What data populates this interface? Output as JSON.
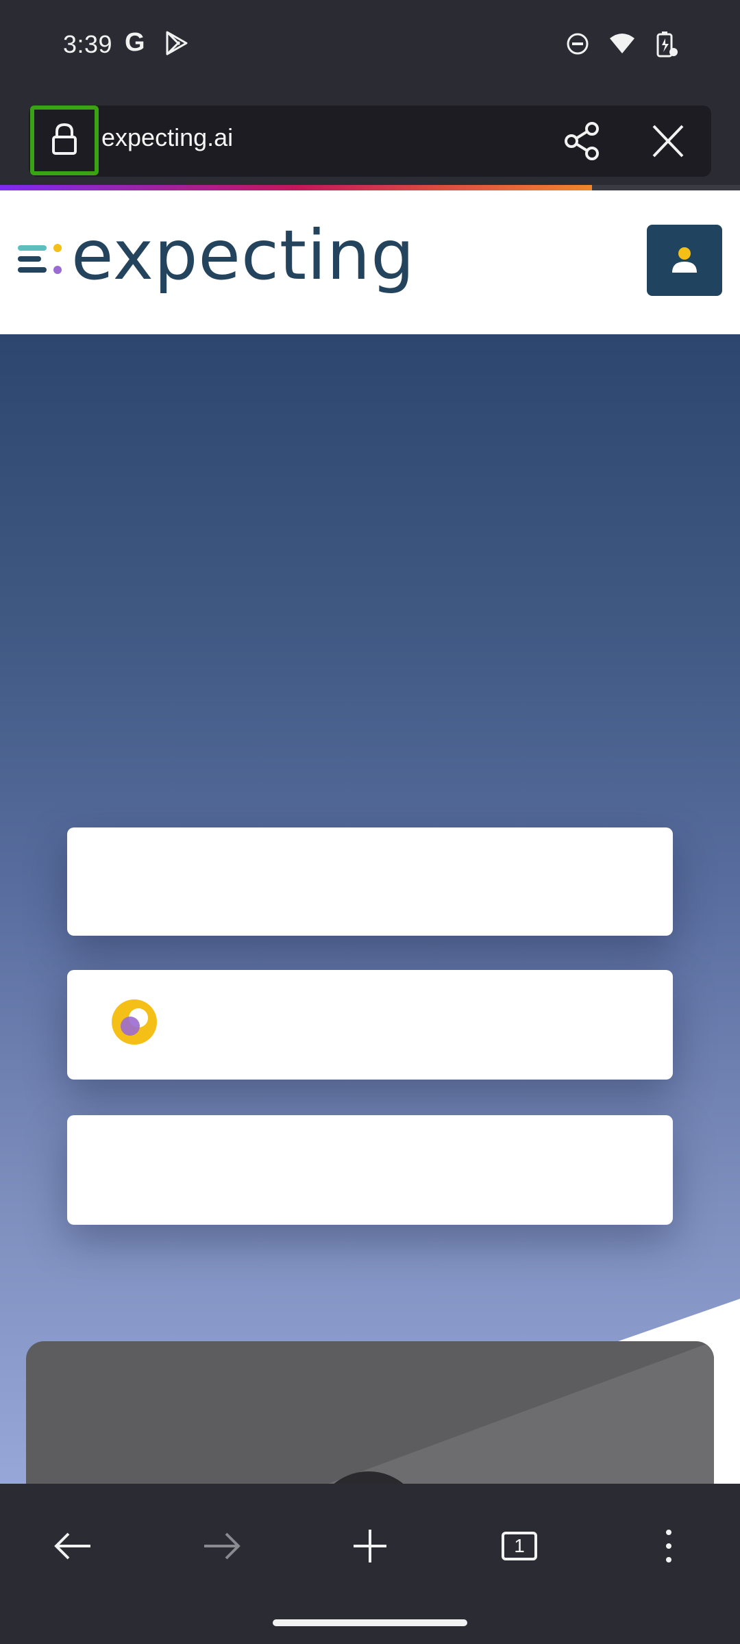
{
  "status_bar": {
    "time": "3:39",
    "icons": [
      "google-g-icon",
      "play-store-icon",
      "do-not-disturb-icon",
      "wifi-icon",
      "battery-charging-icon"
    ]
  },
  "browser": {
    "url": "expecting.ai",
    "tab_count": "1",
    "load_progress": 0.8,
    "icons": [
      "lock-icon",
      "share-icon",
      "close-icon",
      "back-icon",
      "forward-icon",
      "new-tab-icon",
      "tab-switcher-icon",
      "more-menu-icon"
    ]
  },
  "site": {
    "logo_text": "expecting",
    "account_icon": "user-icon"
  },
  "colors": {
    "accent_green": "#3aa315",
    "brand_navy": "#20445f",
    "logo_teal": "#5bbfbf",
    "logo_yellow": "#f4c017",
    "logo_purple": "#9b6bd1"
  }
}
